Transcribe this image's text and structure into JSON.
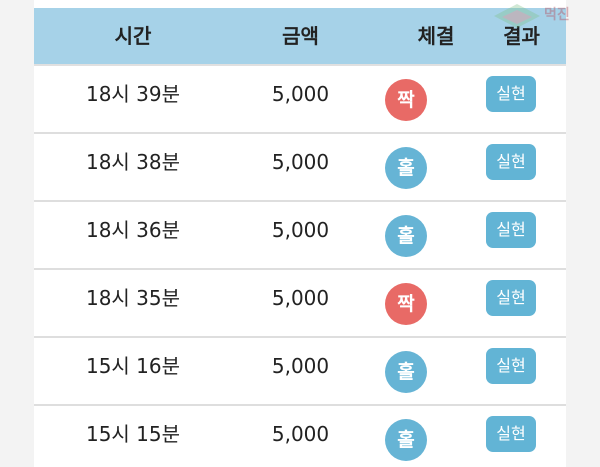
{
  "colors": {
    "header_bg": "#a6d2e8",
    "result_even": "#e86a66",
    "result_odd": "#66b4d5",
    "badge_bg": "#62b4d5"
  },
  "header": {
    "time": "시간",
    "amount": "금액",
    "result": "체결",
    "outcome": "결과"
  },
  "rows": [
    {
      "time": "18시 39분",
      "amount": "5,000",
      "result": "짝",
      "result_color": "#e86a66",
      "outcome": "실현"
    },
    {
      "time": "18시 38분",
      "amount": "5,000",
      "result": "홀",
      "result_color": "#66b4d5",
      "outcome": "실현"
    },
    {
      "time": "18시 36분",
      "amount": "5,000",
      "result": "홀",
      "result_color": "#66b4d5",
      "outcome": "실현"
    },
    {
      "time": "18시 35분",
      "amount": "5,000",
      "result": "짝",
      "result_color": "#e86a66",
      "outcome": "실현"
    },
    {
      "time": "15시 16분",
      "amount": "5,000",
      "result": "홀",
      "result_color": "#66b4d5",
      "outcome": "실현"
    },
    {
      "time": "15시 15분",
      "amount": "5,000",
      "result": "홀",
      "result_color": "#66b4d5",
      "outcome": "실현"
    }
  ],
  "watermark": {
    "text": "먹진",
    "icon": "site-logo-icon"
  }
}
